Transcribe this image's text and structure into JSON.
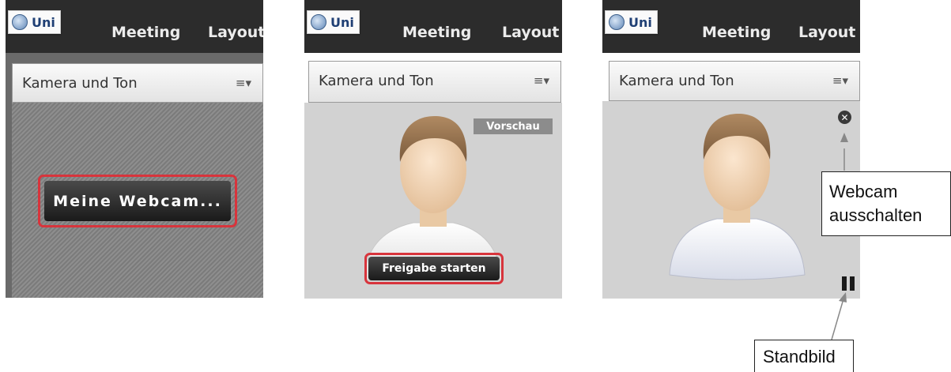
{
  "panels": [
    {
      "logo": "Uni",
      "nav": [
        "Meeting",
        "Layout"
      ],
      "pod_title": "Kamera und Ton",
      "pod_menu_icon": "≡▾",
      "button": "Meine Webcam..."
    },
    {
      "logo": "Uni",
      "nav": [
        "Meeting",
        "Layout"
      ],
      "pod_title": "Kamera und Ton",
      "pod_menu_icon": "≡▾",
      "badge": "Vorschau",
      "button": "Freigabe starten"
    },
    {
      "logo": "Uni",
      "nav": [
        "Meeting",
        "Layout"
      ],
      "pod_title": "Kamera und Ton",
      "pod_menu_icon": "≡▾"
    }
  ],
  "callouts": {
    "webcam_off": [
      "Webcam",
      "ausschalten"
    ],
    "freeze": "Standbild"
  },
  "icons": {
    "close": "close-circle-icon",
    "pause": "pause-icon"
  },
  "colors": {
    "highlight_red": "#d8343c",
    "topbar": "#2c2c2c"
  }
}
